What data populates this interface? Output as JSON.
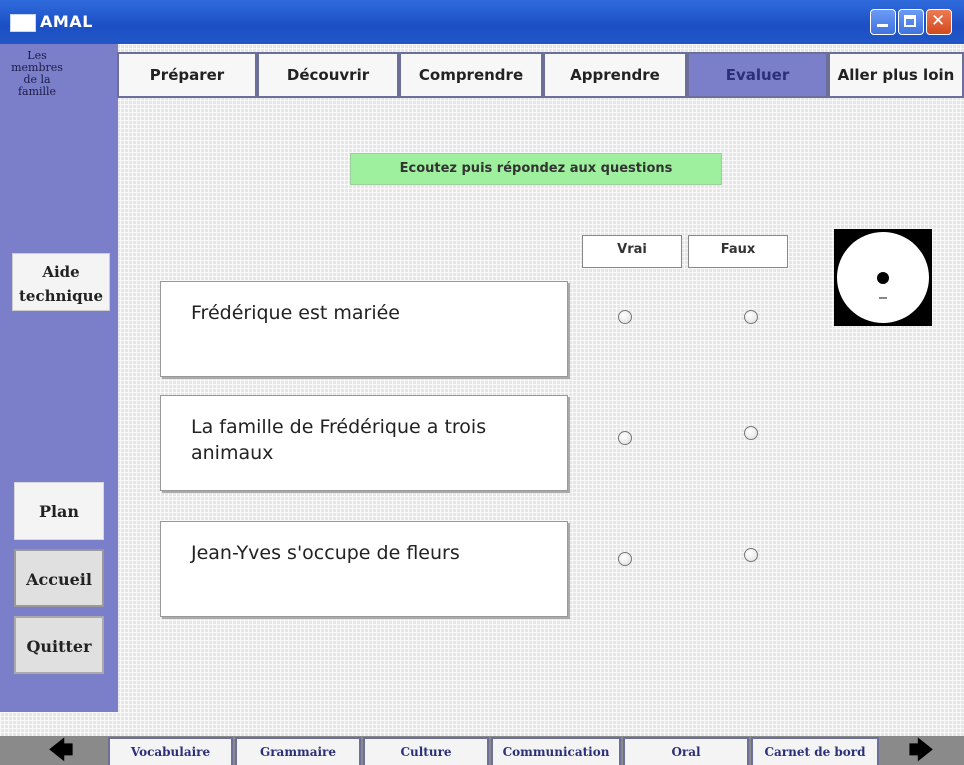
{
  "window": {
    "title": "AMAL"
  },
  "sidebar": {
    "topic_label": "Les membres de la famille",
    "help_label_line1": "Aide",
    "help_label_line2": "technique",
    "plan_label": "Plan",
    "home_label": "Accueil",
    "quit_label": "Quitter"
  },
  "top_tabs": [
    {
      "label": "Préparer"
    },
    {
      "label": "Découvrir"
    },
    {
      "label": "Comprendre"
    },
    {
      "label": "Apprendre"
    },
    {
      "label": "Evaluer",
      "active": true
    },
    {
      "label": "Aller plus loin"
    }
  ],
  "exercise": {
    "instruction": "Ecoutez puis répondez aux questions",
    "true_label": "Vrai",
    "false_label": "Faux",
    "questions": [
      {
        "text": "Frédérique est mariée",
        "answer": null
      },
      {
        "text": "La famille de Frédérique a trois animaux",
        "answer": null
      },
      {
        "text": "Jean-Yves s'occupe de fleurs",
        "answer": null
      }
    ],
    "audio_icon": "cd-icon"
  },
  "bottom_tabs": [
    {
      "label": "Vocabulaire"
    },
    {
      "label": "Grammaire"
    },
    {
      "label": "Culture"
    },
    {
      "label": "Communication"
    },
    {
      "label": "Oral"
    },
    {
      "label": "Carnet de bord"
    }
  ],
  "icons": {
    "prev": "arrow-left-icon",
    "next": "arrow-right-icon"
  },
  "colors": {
    "accent": "#7b7ec8",
    "instruction_bg": "#9ef09e",
    "titlebar": "#1b4fc3"
  }
}
